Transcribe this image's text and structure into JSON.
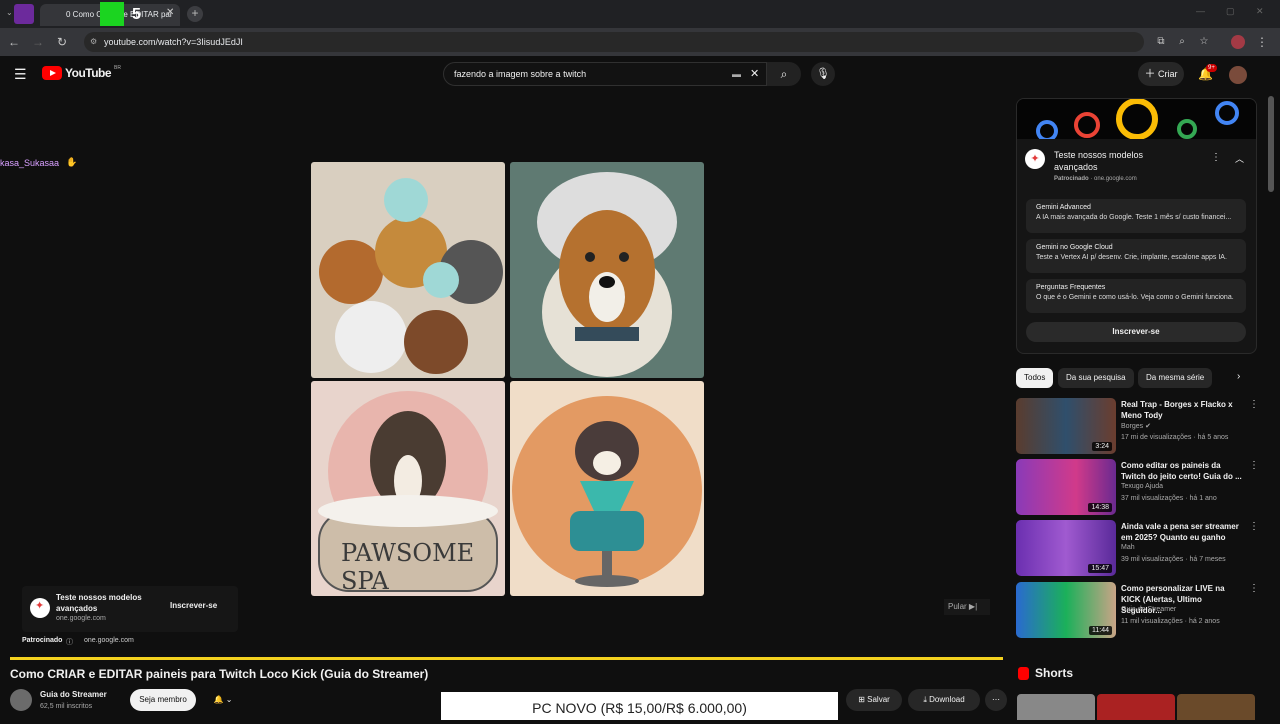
{
  "browser": {
    "tab_title": "0 Como CRIAR e EDITAR pai",
    "url": "youtube.com/watch?v=3IisudJEdJI",
    "overlay_chars": [
      "0",
      "K",
      "5"
    ]
  },
  "header": {
    "logo_text": "YouTube",
    "region": "BR",
    "search_value": "fazendo a imagem sobre a twitch",
    "create_label": "Criar",
    "notif_count": "9+"
  },
  "player": {
    "chat_user": "kasa_Sukasaa",
    "ad_overlay": {
      "title": "Teste nossos modelos avançados",
      "domain": "one.google.com",
      "subscribe_label": "Inscrever-se",
      "sponsored_label": "Patrocinado",
      "sponsored_domain": "one.google.com"
    },
    "skip_label": "Pular",
    "spa_text": "PAWSOME SPA"
  },
  "video": {
    "title": "Como CRIAR e EDITAR paineis para Twitch Loco Kick (Guia do Streamer)",
    "channel": "Guia do Streamer",
    "subscribers": "62,5 mil inscritos",
    "member_label": "Seja membro",
    "save_label": "Salvar",
    "download_label": "Download"
  },
  "banner_text": "PC NOVO (R$ 15,00/R$ 6.000,00)",
  "sidebar": {
    "ad": {
      "title": "Teste nossos modelos avançados",
      "sponsored": "Patrocinado",
      "domain": "one.google.com",
      "rows": [
        {
          "title": "Gemini Advanced",
          "desc": "A IA mais avançada do Google. Teste 1 mês s/ custo financei..."
        },
        {
          "title": "Gemini no Google Cloud",
          "desc": "Teste a Vertex AI p/ desenv. Crie, implante, escalone apps IA."
        },
        {
          "title": "Perguntas Frequentes",
          "desc": "O que é o Gemini e como usá-lo. Veja como o Gemini funciona."
        }
      ],
      "subscribe_label": "Inscrever-se"
    },
    "chips": [
      "Todos",
      "Da sua pesquisa",
      "Da mesma série"
    ],
    "videos": [
      {
        "title": "Real Trap - Borges x Flacko x Meno Tody",
        "channel": "Borges",
        "meta": "17 mi de visualizações · há 5 anos",
        "duration": "3:24"
      },
      {
        "title": "Como editar os paineis da Twitch do jeito certo! Guia do ...",
        "channel": "Texugo Ajuda",
        "meta": "37 mil visualizações · há 1 ano",
        "duration": "14:38"
      },
      {
        "title": "Ainda vale a pena ser streamer em 2025? Quanto eu ganho",
        "channel": "Mah",
        "meta": "39 mil visualizações · há 7 meses",
        "duration": "15:47"
      },
      {
        "title": "Como personalizar LIVE na KICK (Alertas, Ultimo Seguidor...",
        "channel": "Guia do Streamer",
        "meta": "11 mil visualizações · há 2 anos",
        "duration": "11:44"
      }
    ],
    "shorts_label": "Shorts"
  },
  "colors": {
    "yt_red": "#ff0000",
    "progress": "#f4d21f",
    "bg": "#0f0f0f"
  }
}
